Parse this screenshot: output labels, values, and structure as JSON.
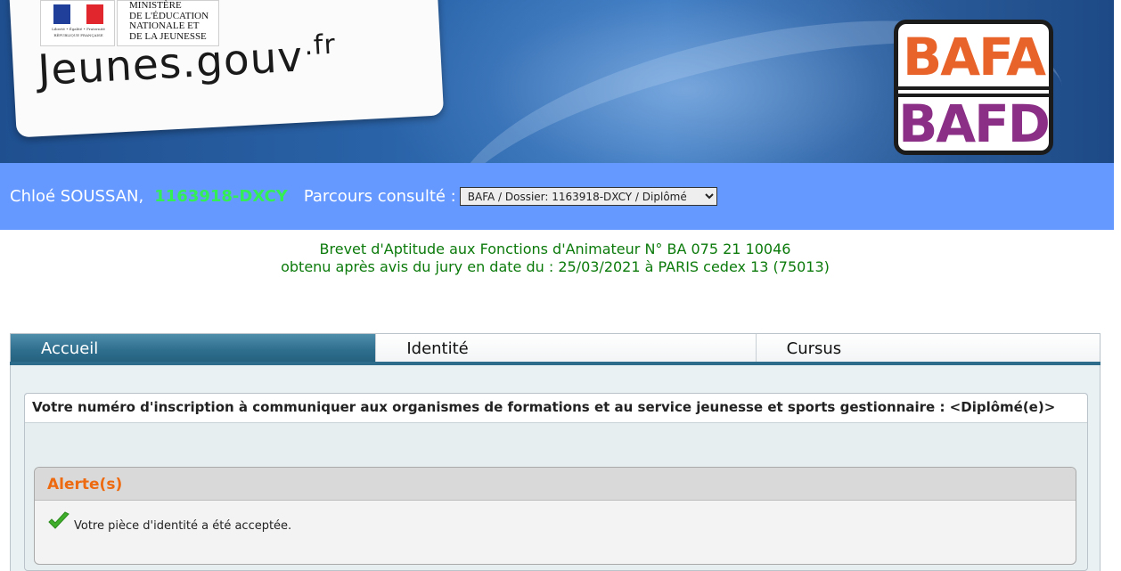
{
  "header": {
    "ministry_text": "MINISTÈRE\nDE L'ÉDUCATION\nNATIONALE ET\nDE LA JEUNESSE",
    "republic_motto": "Liberté • Égalité • Fraternité",
    "republic_name": "RÉPUBLIQUE FRANÇAISE",
    "site_name": "Jeunes.gouv",
    "site_tld": ".fr",
    "program_logo_top": "BAFA",
    "program_logo_bottom": "BAFD",
    "program_logo_top_color": "#e8632a",
    "program_logo_bottom_color": "#8a2e86"
  },
  "userbar": {
    "user_name": "Chloé SOUSSAN,",
    "user_id": "1163918-DXCY",
    "parcours_label": "Parcours consulté :",
    "parcours_selected": "BAFA / Dossier: 1163918-DXCY / Diplômé",
    "background_color": "#6699ff",
    "id_color": "#33ee55"
  },
  "diploma": {
    "line1": "Brevet d'Aptitude aux Fonctions d'Animateur N° BA 075 21 10046",
    "line2": "obtenu après avis du jury en date du : 25/03/2021 à PARIS cedex 13 (75013)",
    "color": "#0b7a0b"
  },
  "tabs": [
    {
      "label": "Accueil",
      "active": true
    },
    {
      "label": "Identité",
      "active": false
    },
    {
      "label": "Cursus",
      "active": false
    }
  ],
  "registration": {
    "header": "Votre numéro d'inscription à communiquer aux organismes de formations et au service jeunesse et sports gestionnaire : <Diplômé(e)>"
  },
  "alerts": {
    "title": "Alerte(s)",
    "title_color": "#ee6a10",
    "items": [
      {
        "icon": "check-icon",
        "text": "Votre pièce d'identité a été acceptée."
      }
    ]
  }
}
